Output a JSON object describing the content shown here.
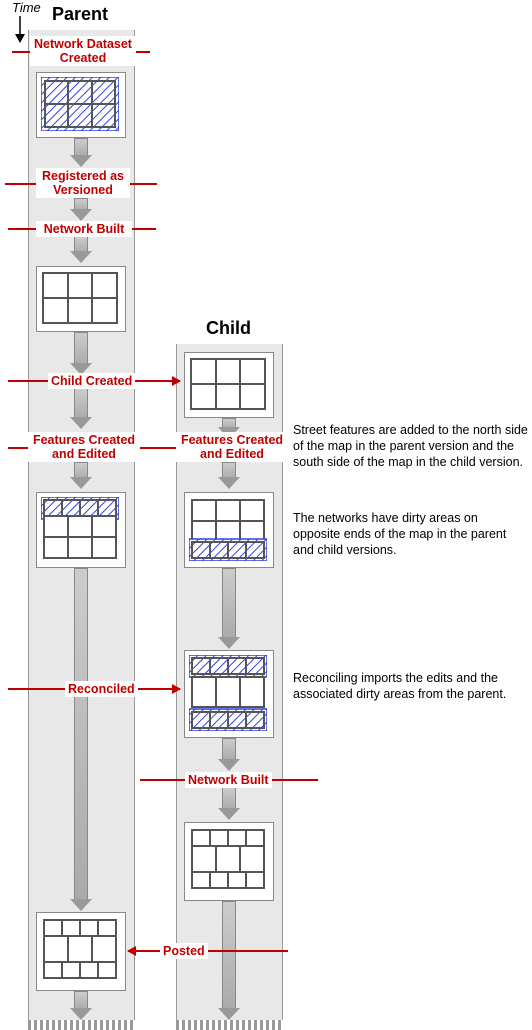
{
  "diagram": {
    "timeLabel": "Time",
    "columns": {
      "parent": "Parent",
      "child": "Child"
    },
    "events": {
      "ndCreated": "Network Dataset Created",
      "regVersioned": "Registered as Versioned",
      "netBuilt1": "Network Built",
      "childCreated": "Child Created",
      "featEditedP": "Features Created and Edited",
      "featEditedC": "Features Created and Edited",
      "reconciled": "Reconciled",
      "netBuilt2": "Network Built",
      "posted": "Posted"
    },
    "notes": {
      "n1": "Street features are added to the north side of the map in the parent version and the south side of the map in the child version.",
      "n2": "The networks have dirty areas on opposite ends of the map in the parent and child versions.",
      "n3": "Reconciling imports the edits and the associated dirty areas from the parent."
    }
  },
  "chart_data": {
    "type": "flow-diagram",
    "lanes": [
      "Parent",
      "Child"
    ],
    "timeline": [
      {
        "lane": "Parent",
        "event": "Network Dataset Created",
        "state": "6-cell grid, full dirty area"
      },
      {
        "lane": "Parent",
        "event": "Registered as Versioned"
      },
      {
        "lane": "Parent",
        "event": "Network Built",
        "state": "6-cell grid, clean"
      },
      {
        "lane": "Parent",
        "event": "Child Created",
        "branchesTo": "Child",
        "childState": "6-cell grid, clean"
      },
      {
        "lane": "Parent",
        "event": "Features Created and Edited",
        "state": "top row split (4 cols) + 2×3 grid below, dirty area on top row"
      },
      {
        "lane": "Child",
        "event": "Features Created and Edited",
        "state": "2×3 grid top + bottom row split (4 cols), dirty area on bottom row"
      },
      {
        "lane": "Child",
        "event": "Reconciled",
        "importsFrom": "Parent",
        "state": "top row 4 cols + middle 1×3 row + bottom row 4 cols, dirty areas top and bottom"
      },
      {
        "lane": "Child",
        "event": "Network Built",
        "state": "top row 4 cols + middle 1×3 row + bottom row 4 cols, clean"
      },
      {
        "lane": "Parent",
        "event": "Posted",
        "importsFrom": "Child",
        "state": "top row 4 cols + middle 1×3 row + bottom row 4 cols, clean"
      }
    ],
    "legend": {
      "dirtyArea": "blue diagonal hatch overlay",
      "clean": "white cells with grey border"
    }
  }
}
